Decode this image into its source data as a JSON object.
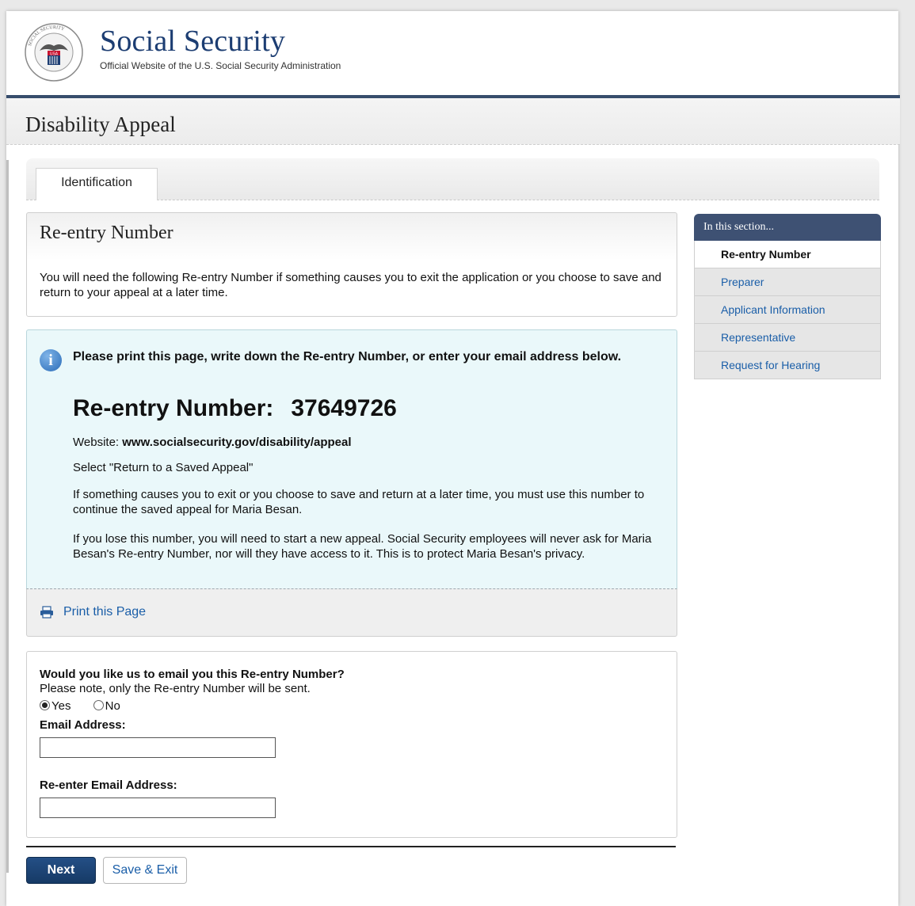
{
  "brand": {
    "title": "Social Security",
    "subtitle": "Official Website of the U.S. Social Security Administration",
    "seal_text": "SOCIAL SECURITY ADMINISTRATION",
    "seal_flag_text": "USA"
  },
  "page_title": "Disability Appeal",
  "tabs": [
    {
      "label": "Identification",
      "active": true
    }
  ],
  "reentry": {
    "title": "Re-entry Number",
    "description": "You will need the following Re-entry Number if something causes you to exit the application or you choose to save and return to your appeal at a later time."
  },
  "info": {
    "icon": "info-icon",
    "heading": "Please print this page, write down the Re-entry Number, or enter your email address below.",
    "number_label": "Re-entry Number:",
    "number_value": "37649726",
    "website_label": "Website:",
    "website_url": "www.socialsecurity.gov/disability/appeal",
    "select_text": "Select \"Return to a Saved Appeal\"",
    "paragraph1": "If something causes you to exit or you choose to save and return at a later time, you must use this number to continue the saved appeal for Maria Besan.",
    "paragraph2": "If you lose this number, you will need to start a new appeal. Social Security employees will never ask for Maria Besan's Re-entry Number, nor will they have access to it. This is to protect Maria Besan's privacy."
  },
  "print": {
    "icon": "printer-icon",
    "label": "Print this Page"
  },
  "email": {
    "question": "Would you like us to email you this Re-entry Number?",
    "note": "Please note, only the Re-entry Number will be sent.",
    "options": [
      "Yes",
      "No"
    ],
    "selected": "Yes",
    "email_label": "Email Address:",
    "email_value": "",
    "reenter_label": "Re-enter Email Address:",
    "reenter_value": ""
  },
  "buttons": {
    "next": "Next",
    "save_exit": "Save & Exit"
  },
  "sidebar": {
    "heading": "In this section...",
    "items": [
      {
        "label": "Re-entry Number",
        "active": true
      },
      {
        "label": "Preparer",
        "active": false
      },
      {
        "label": "Applicant Information",
        "active": false
      },
      {
        "label": "Representative",
        "active": false
      },
      {
        "label": "Request for Hearing",
        "active": false
      }
    ]
  },
  "colors": {
    "brand_blue": "#1c3d72",
    "header_bar": "#374d6c",
    "link_blue": "#1a5ea8",
    "info_bg": "#eaf8fa",
    "button_primary": "#1e4577"
  }
}
